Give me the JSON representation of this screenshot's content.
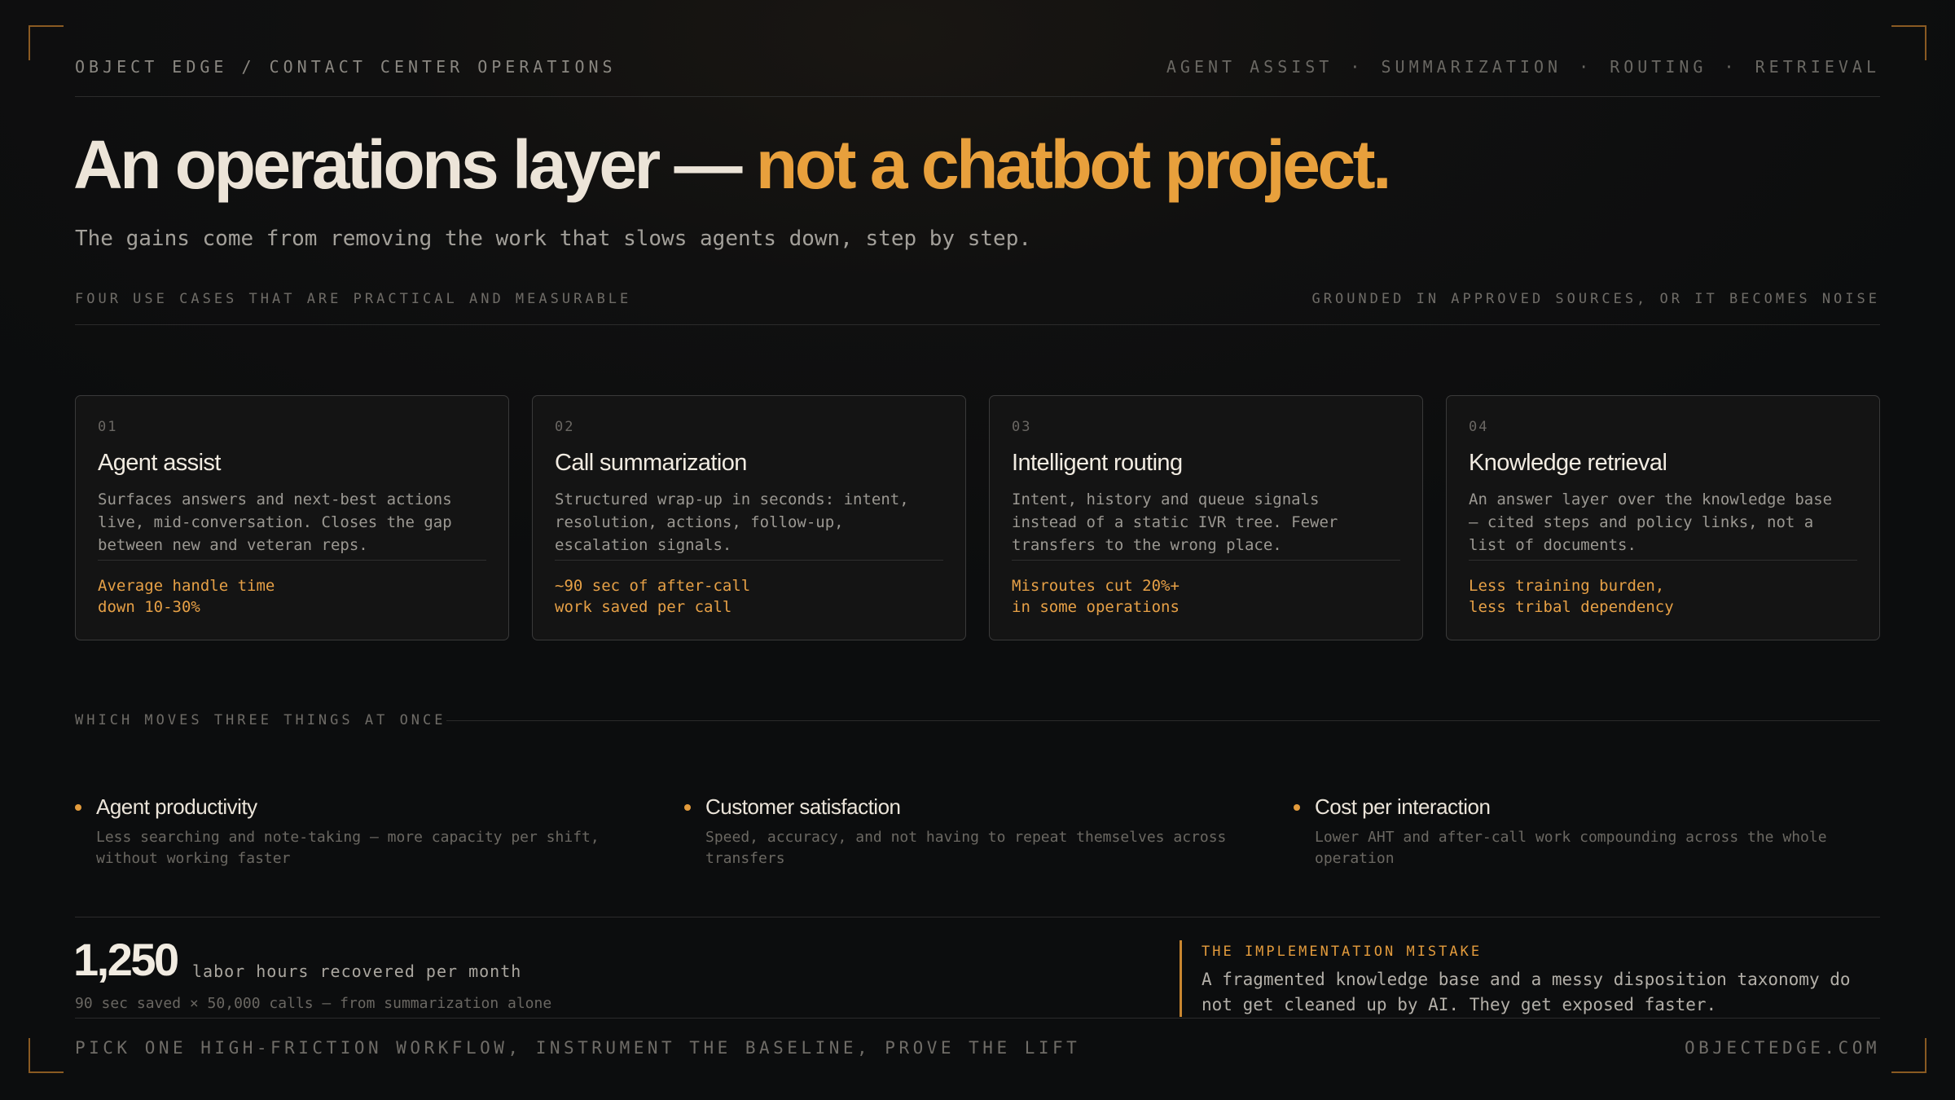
{
  "header": {
    "breadcrumb": "OBJECT EDGE / CONTACT CENTER OPERATIONS",
    "topics": [
      "AGENT ASSIST",
      "SUMMARIZATION",
      "ROUTING",
      "RETRIEVAL"
    ],
    "topic_separator": "·"
  },
  "hero": {
    "title_main": "An operations layer —",
    "title_accent": "not a chatbot project.",
    "subtitle": "The gains come from removing the work that slows agents down, step by step."
  },
  "section": {
    "left_label": "FOUR USE CASES THAT ARE PRACTICAL AND MEASURABLE",
    "right_label": "GROUNDED IN APPROVED SOURCES, OR IT BECOMES NOISE"
  },
  "cards": [
    {
      "num": "01",
      "title": "Agent assist",
      "desc": "Surfaces answers and next-best actions\nlive, mid-conversation. Closes the gap\nbetween new and veteran reps.",
      "metric": "Average handle time\ndown 10-30%"
    },
    {
      "num": "02",
      "title": "Call summarization",
      "desc": "Structured wrap-up in seconds: intent,\nresolution, actions, follow-up,\nescalation signals.",
      "metric": "~90 sec of after-call\nwork saved per call"
    },
    {
      "num": "03",
      "title": "Intelligent routing",
      "desc": "Intent, history and queue signals\ninstead of a static IVR tree. Fewer\ntransfers to the wrong place.",
      "metric": "Misroutes cut 20%+\nin some operations"
    },
    {
      "num": "04",
      "title": "Knowledge retrieval",
      "desc": "An answer layer over the knowledge base\n— cited steps and policy links, not a\nlist of documents.",
      "metric": "Less training burden,\nless tribal dependency"
    }
  ],
  "moves": {
    "label": "WHICH MOVES THREE THINGS AT ONCE",
    "items": [
      {
        "title": "Agent productivity",
        "desc": "Less searching and note-taking — more capacity per shift, without working faster"
      },
      {
        "title": "Customer satisfaction",
        "desc": "Speed, accuracy, and not having to repeat themselves across transfers"
      },
      {
        "title": "Cost per interaction",
        "desc": "Lower AHT and after-call work compounding across the whole operation"
      }
    ]
  },
  "stat": {
    "value": "1,250",
    "label": "labor hours recovered per month",
    "sub": "90 sec saved × 50,000 calls — from summarization alone"
  },
  "callout": {
    "label": "THE IMPLEMENTATION MISTAKE",
    "text": "A fragmented knowledge base and a messy disposition taxonomy do not get cleaned up by AI. They get exposed faster."
  },
  "footer": {
    "left": "PICK ONE HIGH-FRICTION WORKFLOW, INSTRUMENT THE BASELINE, PROVE THE LIFT",
    "right": "OBJECTEDGE.COM"
  },
  "colors": {
    "accent": "#e8a03c",
    "background": "#0d0d0d",
    "text": "#ece4d8"
  }
}
